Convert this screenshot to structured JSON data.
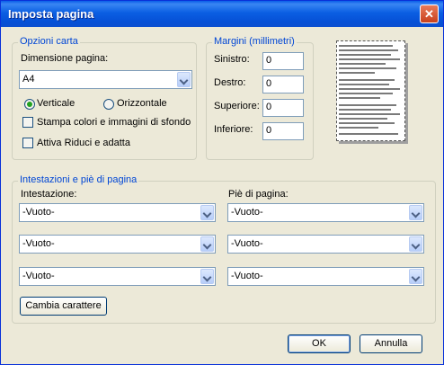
{
  "window": {
    "title": "Imposta pagina",
    "close_glyph": "✕"
  },
  "paper": {
    "legend": "Opzioni carta",
    "size_label": "Dimensione pagina:",
    "size_value": "A4",
    "portrait_label": "Verticale",
    "landscape_label": "Orizzontale",
    "print_bg_label": "Stampa colori e immagini di sfondo",
    "shrink_label": "Attiva Riduci e adatta",
    "orientation_selected": "Verticale"
  },
  "margins": {
    "legend": "Margini (millimetri)",
    "left_label": "Sinistro:",
    "left_value": "0",
    "right_label": "Destro:",
    "right_value": "0",
    "top_label": "Superiore:",
    "top_value": "0",
    "bottom_label": "Inferiore:",
    "bottom_value": "0"
  },
  "headers": {
    "legend": "Intestazioni e piè di pagina",
    "header_label": "Intestazione:",
    "footer_label": "Piè di pagina:",
    "header_values": [
      "-Vuoto-",
      "-Vuoto-",
      "-Vuoto-"
    ],
    "footer_values": [
      "-Vuoto-",
      "-Vuoto-",
      "-Vuoto-"
    ],
    "font_button": "Cambia carattere"
  },
  "buttons": {
    "ok": "OK",
    "cancel": "Annulla"
  },
  "colors": {
    "legend": "#0046d5",
    "titlebar": "#0b5fe3",
    "dialog_bg": "#ece9d8"
  }
}
